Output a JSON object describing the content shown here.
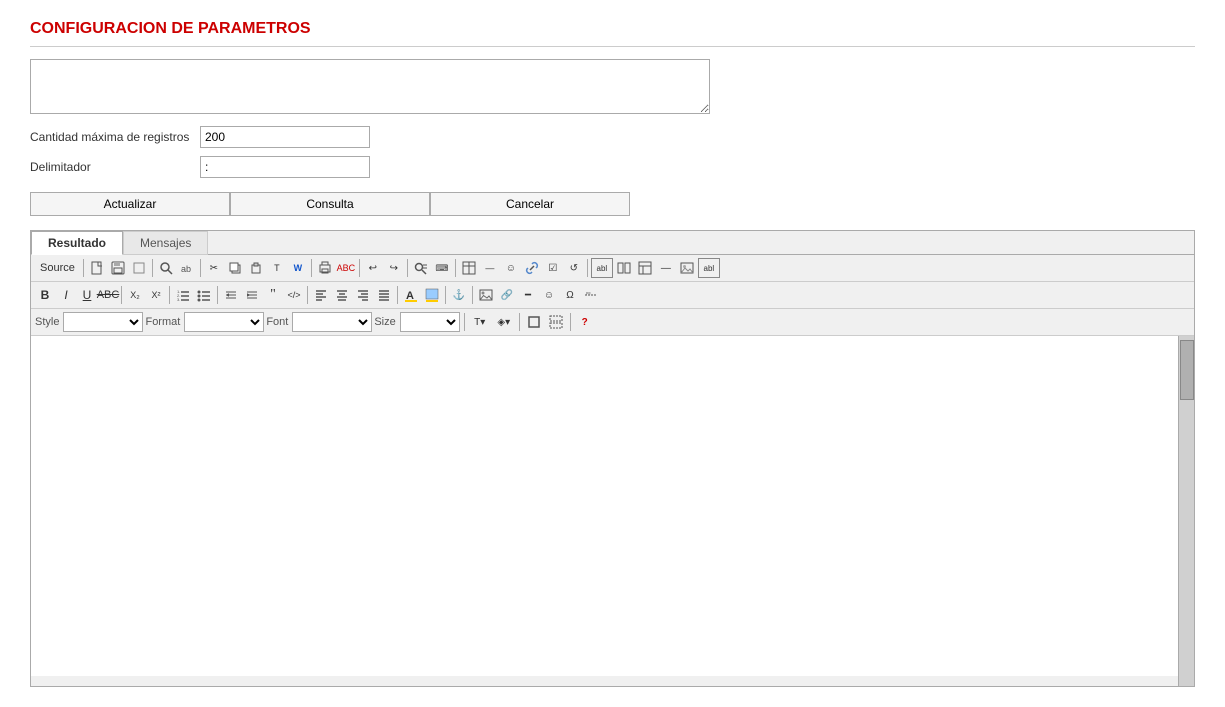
{
  "page": {
    "title": "CONFIGURACION DE PARAMETROS"
  },
  "form": {
    "description_placeholder": "",
    "max_records_label": "Cantidad máxima de registros",
    "max_records_value": "200",
    "delimiter_label": "Delimitador",
    "delimiter_value": ":"
  },
  "buttons": {
    "actualizar": "Actualizar",
    "consulta": "Consulta",
    "cancelar": "Cancelar"
  },
  "tabs": {
    "resultado": "Resultado",
    "mensajes": "Mensajes"
  },
  "toolbar": {
    "source": "Source",
    "style_label": "Style",
    "format_label": "Format",
    "font_label": "Font",
    "size_label": "Size"
  }
}
